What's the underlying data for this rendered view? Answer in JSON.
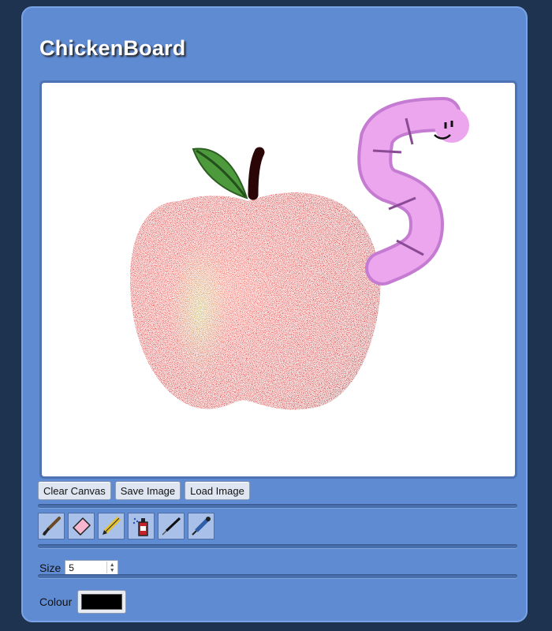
{
  "app": {
    "title": "ChickenBoard"
  },
  "buttons": {
    "clear_canvas": "Clear Canvas",
    "save_image": "Save Image",
    "load_image": "Load Image"
  },
  "tools": [
    {
      "name": "brush-icon"
    },
    {
      "name": "eraser-icon"
    },
    {
      "name": "pencil-icon"
    },
    {
      "name": "spray-can-icon"
    },
    {
      "name": "pen-icon"
    },
    {
      "name": "eyedropper-icon"
    }
  ],
  "size": {
    "label": "Size",
    "value": "5"
  },
  "colour": {
    "label": "Colour",
    "value": "#000000"
  },
  "colors": {
    "background": "#1e3350",
    "panel": "#5f8bd3",
    "canvas": "#ffffff"
  }
}
